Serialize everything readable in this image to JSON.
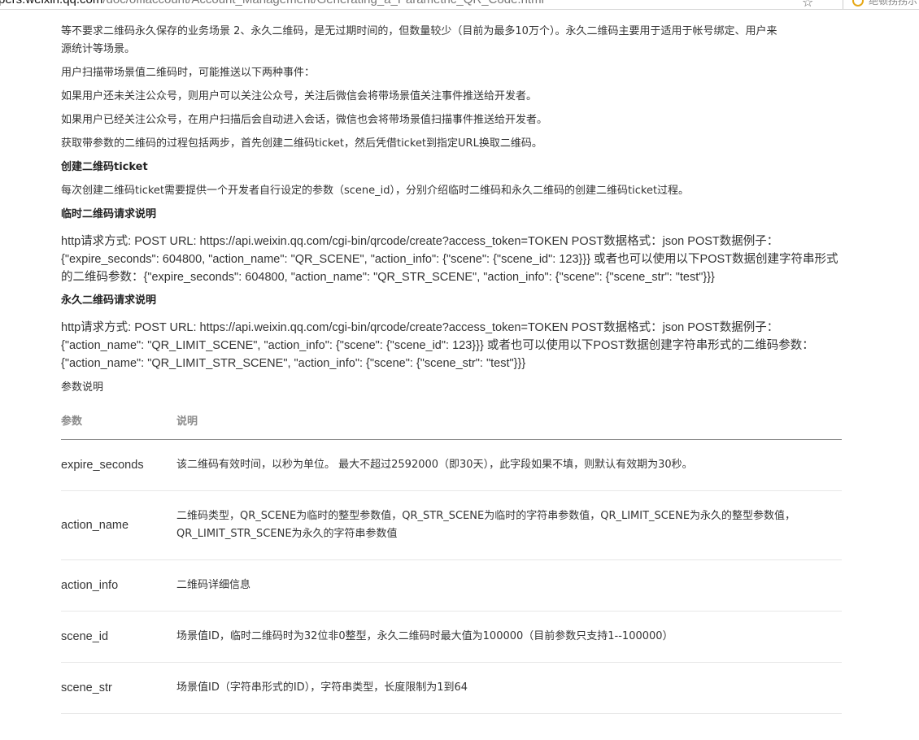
{
  "browser": {
    "url_domain": "pers.weixin.qq.com",
    "url_path": "/doc/offiaccount/Account_Management/Generating_a_Parametric_QR_Code.html",
    "extension_label": "绝顿拐拐示"
  },
  "article": {
    "intro_line1": "等不要求二维码永久保存的业务场景 2、永久二维码，是无过期时间的，但数量较少（目前为最多10万个）。永久二维码主要用于适用于帐号绑定、用户来",
    "intro_line2": "源统计等场景。",
    "events_intro": "用户扫描带场景值二维码时，可能推送以下两种事件：",
    "event_not_followed": "如果用户还未关注公众号，则用户可以关注公众号，关注后微信会将带场景值关注事件推送给开发者。",
    "event_followed": "如果用户已经关注公众号，在用户扫描后会自动进入会话，微信也会将带场景值扫描事件推送给开发者。",
    "process_intro": "获取带参数的二维码的过程包括两步，首先创建二维码ticket，然后凭借ticket到指定URL换取二维码。",
    "create_heading": "创建二维码ticket",
    "create_desc": "每次创建二维码ticket需要提供一个开发者自行设定的参数（scene_id），分别介绍临时二维码和永久二维码的创建二维码ticket过程。",
    "temp_heading": "临时二维码请求说明",
    "temp_code": [
      "http请求方式: POST URL: https://api.weixin.qq.com/cgi-bin/qrcode/create?access_token=TOKEN POST数据格式：json POST数据例子：",
      "{\"expire_seconds\": 604800, \"action_name\": \"QR_SCENE\", \"action_info\": {\"scene\": {\"scene_id\": 123}}} 或者也可以使用以下POST数据创建字符串形式",
      "的二维码参数：{\"expire_seconds\": 604800, \"action_name\": \"QR_STR_SCENE\", \"action_info\": {\"scene\": {\"scene_str\": \"test\"}}}"
    ],
    "perm_heading": "永久二维码请求说明",
    "perm_code": [
      "http请求方式: POST URL: https://api.weixin.qq.com/cgi-bin/qrcode/create?access_token=TOKEN POST数据格式：json POST数据例子：",
      "{\"action_name\": \"QR_LIMIT_SCENE\", \"action_info\": {\"scene\": {\"scene_id\": 123}}} 或者也可以使用以下POST数据创建字符串形式的二维码参数：",
      "{\"action_name\": \"QR_LIMIT_STR_SCENE\", \"action_info\": {\"scene\": {\"scene_str\": \"test\"}}}"
    ],
    "params_label": "参数说明"
  },
  "params_table": {
    "headers": [
      "参数",
      "说明"
    ],
    "rows": [
      {
        "param": "expire_seconds",
        "desc": "该二维码有效时间，以秒为单位。 最大不超过2592000（即30天），此字段如果不填，则默认有效期为30秒。"
      },
      {
        "param": "action_name",
        "desc": "二维码类型，QR_SCENE为临时的整型参数值，QR_STR_SCENE为临时的字符串参数值，QR_LIMIT_SCENE为永久的整型参数值，QR_LIMIT_STR_SCENE为永久的字符串参数值"
      },
      {
        "param": "action_info",
        "desc": "二维码详细信息"
      },
      {
        "param": "scene_id",
        "desc": "场景值ID，临时二维码时为32位非0整型，永久二维码时最大值为100000（目前参数只支持1--100000）"
      },
      {
        "param": "scene_str",
        "desc": "场景值ID（字符串形式的ID），字符串类型，长度限制为1到64"
      }
    ]
  }
}
